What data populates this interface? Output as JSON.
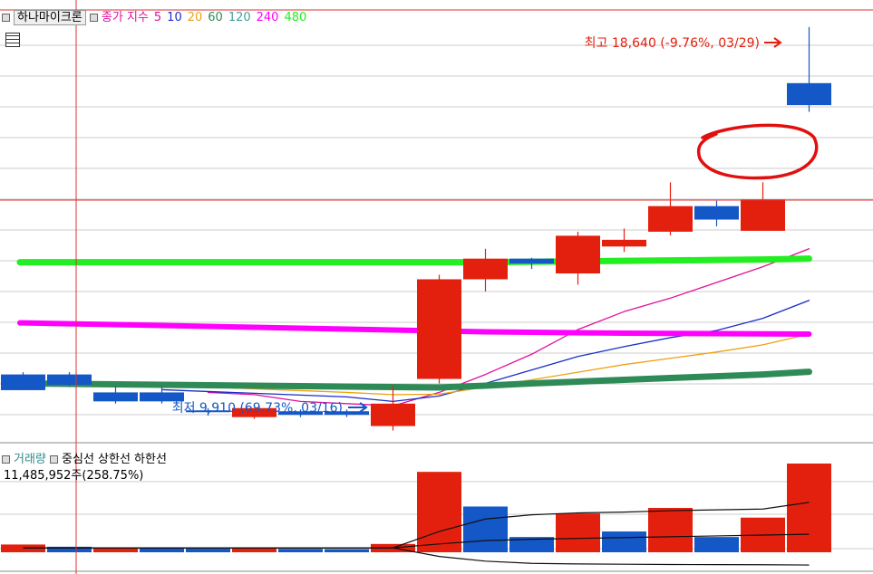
{
  "header": {
    "stock_name": "하나마이크론",
    "ma_title": "종가 지수",
    "ma_periods": [
      {
        "label": "5",
        "color": "#e0109e"
      },
      {
        "label": "10",
        "color": "#1a2ec8"
      },
      {
        "label": "20",
        "color": "#f0a010"
      },
      {
        "label": "60",
        "color": "#2e8b57"
      },
      {
        "label": "120",
        "color": "#40a0a0"
      },
      {
        "label": "240",
        "color": "#ff00ff"
      },
      {
        "label": "480",
        "color": "#22ee22"
      }
    ]
  },
  "volume_header": {
    "title": "거래량",
    "indicators": "중심선  상한선  하한선",
    "info": "11,485,952주(258.75%)"
  },
  "annotations": {
    "high": "최고 18,640 (-9.76%, 03/29)",
    "low": "최저 9,910 (69.73%, 03/16)"
  },
  "colors": {
    "up": "#e3200e",
    "down": "#1457c6",
    "grid": "#cccccc",
    "crosshair": "#e03030"
  },
  "chart_data": [
    {
      "type": "candlestick",
      "ylim": [
        9500,
        19000
      ],
      "candles": [
        {
          "o": 10900,
          "h": 10950,
          "l": 10550,
          "c": 10550
        },
        {
          "o": 10900,
          "h": 10950,
          "l": 10620,
          "c": 10670
        },
        {
          "o": 10500,
          "h": 10640,
          "l": 10250,
          "c": 10300
        },
        {
          "o": 10500,
          "h": 10640,
          "l": 10250,
          "c": 10300
        },
        {
          "o": 10100,
          "h": 10150,
          "l": 9980,
          "c": 10080
        },
        {
          "o": 9950,
          "h": 10150,
          "l": 9910,
          "c": 10150
        },
        {
          "o": 10080,
          "h": 10120,
          "l": 9950,
          "c": 10000
        },
        {
          "o": 10080,
          "h": 10120,
          "l": 9950,
          "c": 10000
        },
        {
          "o": 9750,
          "h": 10650,
          "l": 9650,
          "c": 10250
        },
        {
          "o": 10800,
          "h": 13120,
          "l": 10700,
          "c": 13020
        },
        {
          "o": 13020,
          "h": 13700,
          "l": 12750,
          "c": 13480
        },
        {
          "o": 13480,
          "h": 13500,
          "l": 13250,
          "c": 13370
        },
        {
          "o": 13150,
          "h": 14080,
          "l": 12900,
          "c": 13990
        },
        {
          "o": 13750,
          "h": 14150,
          "l": 13630,
          "c": 13900
        },
        {
          "o": 14080,
          "h": 15180,
          "l": 14000,
          "c": 14650
        },
        {
          "o": 14650,
          "h": 14770,
          "l": 14200,
          "c": 14350
        },
        {
          "o": 14100,
          "h": 15180,
          "l": 14100,
          "c": 14800
        },
        {
          "o": 17390,
          "h": 18640,
          "l": 16750,
          "c": 16900
        }
      ],
      "moving_averages": [
        {
          "period": "5",
          "color": "#e0109e",
          "values": [
            null,
            null,
            null,
            null,
            10500,
            10450,
            10300,
            10250,
            10200,
            10500,
            10900,
            11350,
            11900,
            12300,
            12600,
            12950,
            13300,
            13700
          ]
        },
        {
          "period": "10",
          "color": "#1a2ec8",
          "values": [
            null,
            null,
            null,
            10560,
            10520,
            10480,
            10440,
            10400,
            10300,
            10420,
            10700,
            11000,
            11300,
            11520,
            11720,
            11880,
            12150,
            12550
          ]
        },
        {
          "period": "20",
          "color": "#f0a010",
          "values": [
            null,
            null,
            null,
            10650,
            10620,
            10580,
            10540,
            10500,
            10450,
            10460,
            10620,
            10780,
            10950,
            11120,
            11260,
            11400,
            11560,
            11800
          ]
        },
        {
          "period": "60",
          "color": "#2e8b57",
          "values": [
            10700,
            10690,
            10680,
            10670,
            10660,
            10650,
            10640,
            10630,
            10620,
            10610,
            10650,
            10700,
            10740,
            10780,
            10820,
            10860,
            10900,
            10960
          ]
        },
        {
          "period": "240",
          "color": "#ff00ff",
          "values": [
            12050,
            12030,
            12010,
            11990,
            11970,
            11950,
            11930,
            11910,
            11890,
            11870,
            11850,
            11840,
            11830,
            11820,
            11815,
            11810,
            11805,
            11800
          ]
        },
        {
          "period": "480",
          "color": "#22ee22",
          "values": [
            13400,
            13400,
            13400,
            13400,
            13400,
            13400,
            13400,
            13400,
            13400,
            13400,
            13400,
            13410,
            13420,
            13430,
            13440,
            13450,
            13460,
            13480
          ]
        }
      ],
      "high_marker": {
        "value": 18640,
        "date": "03/29"
      },
      "low_marker": {
        "value": 9910,
        "date": "03/16"
      }
    },
    {
      "type": "volume",
      "ylim": [
        0,
        3200000
      ],
      "unit": "주",
      "bars": [
        {
          "v": 280000,
          "up": true
        },
        {
          "v": 200000,
          "up": false
        },
        {
          "v": 150000,
          "up": true
        },
        {
          "v": 170000,
          "up": false
        },
        {
          "v": 130000,
          "up": false
        },
        {
          "v": 160000,
          "up": true
        },
        {
          "v": 120000,
          "up": false
        },
        {
          "v": 110000,
          "up": false
        },
        {
          "v": 300000,
          "up": true
        },
        {
          "v": 2900000,
          "up": true
        },
        {
          "v": 1650000,
          "up": false
        },
        {
          "v": 550000,
          "up": false
        },
        {
          "v": 1400000,
          "up": true
        },
        {
          "v": 750000,
          "up": false
        },
        {
          "v": 1600000,
          "up": true
        },
        {
          "v": 550000,
          "up": false
        },
        {
          "v": 1250000,
          "up": true
        },
        {
          "v": 3200000,
          "up": true
        }
      ],
      "center_line": [
        160000,
        160000,
        160000,
        160000,
        160000,
        160000,
        160000,
        160000,
        160000,
        300000,
        420000,
        470000,
        500000,
        530000,
        560000,
        590000,
        620000,
        650000
      ],
      "upper_line": [
        160000,
        160000,
        160000,
        160000,
        160000,
        160000,
        160000,
        160000,
        160000,
        750000,
        1200000,
        1350000,
        1420000,
        1450000,
        1500000,
        1530000,
        1560000,
        1800000
      ],
      "lower_line": [
        160000,
        160000,
        160000,
        160000,
        160000,
        160000,
        160000,
        160000,
        160000,
        -150000,
        -320000,
        -400000,
        -420000,
        -430000,
        -440000,
        -445000,
        -450000,
        -460000
      ]
    }
  ]
}
